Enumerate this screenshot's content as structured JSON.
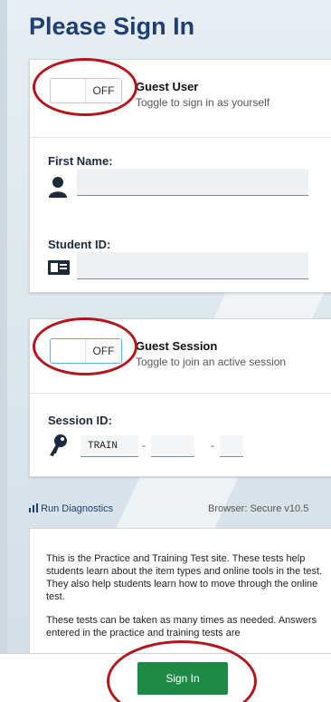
{
  "page": {
    "title": "Please Sign In"
  },
  "guest_user": {
    "toggle_state": "OFF",
    "title": "Guest User",
    "subtitle": "Toggle to sign in as yourself"
  },
  "fields": {
    "first_name_label": "First Name:",
    "first_name_value": "",
    "student_id_label": "Student ID:",
    "student_id_value": ""
  },
  "guest_session": {
    "toggle_state": "OFF",
    "title": "Guest Session",
    "subtitle": "Toggle to join an active session",
    "session_id_label": "Session ID:",
    "session_prefix": "TRAIN",
    "session_part2": "",
    "session_part3": "",
    "separator": "-"
  },
  "footer_links": {
    "diagnostics": "Run Diagnostics",
    "browser": "Browser: Secure v10.5"
  },
  "info": {
    "paragraph1": "This is the Practice and Training Test site. These tests help students learn about the item types and online tools in the test. They also help students learn how to move through the online test.",
    "paragraph2": "These tests can be taken as many times as needed. Answers entered in the practice and training tests are"
  },
  "actions": {
    "sign_in": "Sign In"
  },
  "icons": [
    "person-icon",
    "id-card-icon",
    "key-icon",
    "bar-chart-icon"
  ],
  "colors": {
    "title": "#1f3f73",
    "sign_in": "#1e8a46",
    "annotation_ring": "#b4151c"
  }
}
